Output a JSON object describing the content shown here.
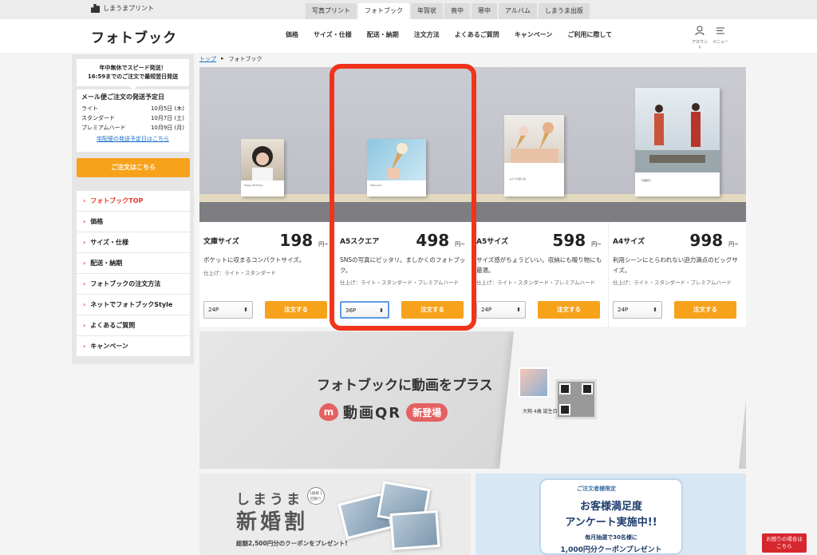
{
  "brand": {
    "small_name": "しまうまプリント",
    "page_title": "フォトブック"
  },
  "top_tabs": [
    {
      "label": "写真プリント",
      "active": false
    },
    {
      "label": "フォトブック",
      "active": true
    },
    {
      "label": "年賀状",
      "active": false
    },
    {
      "label": "喪中",
      "active": false
    },
    {
      "label": "寒中",
      "active": false
    },
    {
      "label": "アルバム",
      "active": false
    },
    {
      "label": "しまうま出版",
      "active": false
    }
  ],
  "main_nav": [
    "価格",
    "サイズ・仕様",
    "配送・納期",
    "注文方法",
    "よくあるご質問",
    "キャンペーン",
    "ご利用に際して"
  ],
  "header_icons": {
    "account_label": "アカウント",
    "menu_label": "メニュー"
  },
  "breadcrumb": {
    "home": "トップ",
    "separator": "▸",
    "current": "フォトブック"
  },
  "sidebar": {
    "ship_line1": "年中無休でスピード発送！",
    "ship_line2": "16:59までのご注文で最短翌日発送",
    "mail_title": "メール便ご注文の発送予定日",
    "mail_rows": [
      {
        "label": "ライト",
        "date": "10月5日 (木)"
      },
      {
        "label": "スタンダード",
        "date": "10月7日 (土)"
      },
      {
        "label": "プレミアムハード",
        "date": "10月9日 (月)"
      }
    ],
    "mail_link": "宅配便の発送予定日はこちら",
    "order_button": "ご注文はこちら",
    "menu": [
      {
        "label": "フォトブックTOP",
        "active": true
      },
      {
        "label": "価格",
        "active": false
      },
      {
        "label": "サイズ・仕様",
        "active": false
      },
      {
        "label": "配送・納期",
        "active": false
      },
      {
        "label": "フォトブックの注文方法",
        "active": false
      },
      {
        "label": "ネットでフォトブックStyle",
        "active": false
      },
      {
        "label": "よくあるご質問",
        "active": false
      },
      {
        "label": "キャンペーン",
        "active": false
      }
    ]
  },
  "hero_captions": {
    "bunko": "Happy Birthday",
    "a5sq": "Memories",
    "a5": "ふたりの思い出",
    "a4": "卒業旅行"
  },
  "products": [
    {
      "name": "文庫サイズ",
      "price": "198",
      "unit": "円~",
      "desc": "ポケットに収まるコンパクトサイズ。",
      "spec": "仕上げ：ライト・スタンダード",
      "select": "24P",
      "order": "注文する"
    },
    {
      "name": "A5スクエア",
      "price": "498",
      "unit": "円~",
      "desc": "SNSの写真にピッタリ。ましかくのフォトブック。",
      "spec": "仕上げ：ライト・スタンダード・プレミアムハード",
      "select": "36P",
      "order": "注文する"
    },
    {
      "name": "A5サイズ",
      "price": "598",
      "unit": "円~",
      "desc": "サイズ感がちょうどいい。収納にも贈り物にも最適。",
      "spec": "仕上げ：ライト・スタンダード・プレミアムハード",
      "select": "24P",
      "order": "注文する"
    },
    {
      "name": "A4サイズ",
      "price": "998",
      "unit": "円~",
      "desc": "利用シーンにとらわれない迫力満点のビッグサイズ。",
      "spec": "仕上げ：ライト・スタンダード・プレミアムハード",
      "select": "24P",
      "order": "注文する"
    }
  ],
  "qr_banner": {
    "title": "フォトブックに動画をプラス",
    "heart": "m",
    "name": "動画QR",
    "badge": "新登場",
    "caption": "大翔 4歳 誕生日"
  },
  "wedding_banner": {
    "top": "しまうま",
    "main": "新婚割",
    "badge": "1組様 1回限り",
    "note": "総額2,500円分のクーポンをプレゼント!"
  },
  "survey_banner": {
    "limited": "ご注文者様限定",
    "line1": "お客様満足度",
    "line2": "アンケート実施中!!",
    "line3": "毎月抽選で30名様に",
    "line4": "1,000円分クーポンプレゼント"
  },
  "help_button": {
    "line1": "お困りの場合は",
    "line2": "こちら"
  },
  "colors": {
    "accent_orange": "#f7a21b",
    "highlight_red": "#f0341c",
    "link_blue": "#1a6fd1"
  }
}
